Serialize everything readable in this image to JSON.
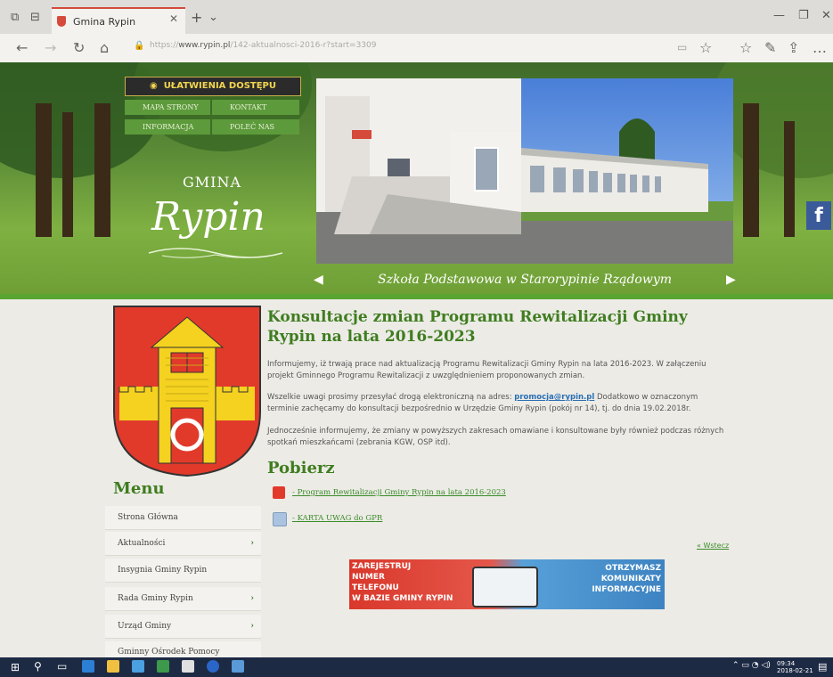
{
  "browser": {
    "tab_title": "Gmina Rypin",
    "url_domain": "www.rypin.pl",
    "url_prefix": "https://",
    "url_path": "/142-aktualnosci-2016-r?start=3309"
  },
  "header": {
    "accessibility_label": "UŁATWIENIA DOSTĘPU",
    "quick_links": [
      "MAPA STRONY",
      "KONTAKT",
      "INFORMACJA",
      "POLEĆ NAS"
    ],
    "logo_top": "GMINA",
    "logo_main": "Rypin",
    "slide_caption": "Szkoła Podstawowa w Starorypinie Rządowym",
    "facebook_label": "f"
  },
  "article": {
    "title": "Konsultacje zmian Programu Rewitalizacji Gminy Rypin na lata 2016-2023",
    "p1": "Informujemy, iż trwają prace nad aktualizacją Programu Rewitalizacji Gminy Rypin na lata 2016-2023. W załączeniu projekt Gminnego Programu Rewitalizacji z uwzględnieniem proponowanych zmian.",
    "p2_before": "Wszelkie uwagi prosimy przesyłać drogą elektroniczną na adres: ",
    "p2_email": "promocja@rypin.pl",
    "p2_after": " Dodatkowo w oznaczonym terminie zachęcamy do konsultacji bezpośrednio w Urzędzie Gminy Rypin (pokój nr 14), tj. do dnia 19.02.2018r.",
    "p3": "Jednocześnie informujemy, że zmiany w powyższych zakresach omawiane i konsultowane były również podczas różnych spotkań mieszkańcami (zebrania KGW, OSP itd).",
    "download_heading": "Pobierz",
    "downloads": [
      "- Program Rewitalizacji Gminy Rypin na lata 2016-2023",
      "- KARTA UWAG do GPR"
    ],
    "back_link": "« Wstecz"
  },
  "promo": {
    "left_text": [
      "ZAREJESTRUJ",
      "NUMER",
      "TELEFONU",
      "W BAZIE GMINY RYPIN"
    ],
    "right_text": [
      "OTRZYMASZ",
      "KOMUNIKATY",
      "INFORMACYJNE"
    ]
  },
  "sidebar": {
    "menu_heading": "Menu",
    "items": [
      {
        "label": "Strona Główna",
        "chevron": ""
      },
      {
        "label": "Aktualności",
        "chevron": "›"
      },
      {
        "label": "Insygnia Gminy Rypin",
        "chevron": ""
      },
      {
        "label": "Rada Gminy Rypin",
        "chevron": "›"
      },
      {
        "label": "Urząd Gminy",
        "chevron": "›"
      },
      {
        "label": "Gminny Ośrodek Pomocy",
        "chevron": ""
      }
    ]
  },
  "taskbar": {
    "time": "09:34",
    "date": "2018-02-21"
  },
  "colors": {
    "brand_green": "#3f7d1f",
    "banner_green": "#5aa532",
    "coat_red": "#e13a2b",
    "coat_yellow": "#f4d21f"
  }
}
